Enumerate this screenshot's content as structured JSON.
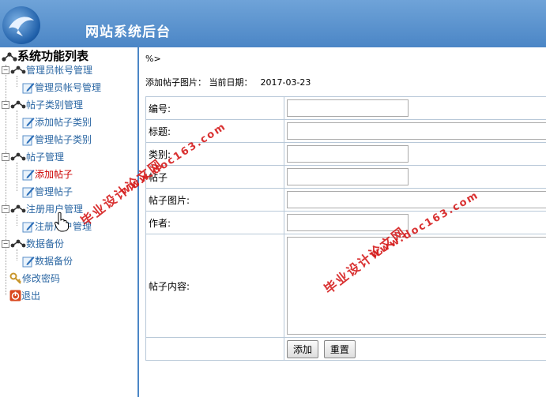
{
  "header": {
    "title": "网站系统后台"
  },
  "sidebar": {
    "root": "系统功能列表",
    "groups": [
      {
        "label": "管理员帐号管理",
        "items": [
          "管理员帐号管理"
        ]
      },
      {
        "label": "帖子类别管理",
        "items": [
          "添加帖子类别",
          "管理帖子类别"
        ]
      },
      {
        "label": "帖子管理",
        "items": [
          "添加帖子",
          "管理帖子"
        ]
      },
      {
        "label": "注册用户管理",
        "items": [
          "注册用户管理"
        ]
      },
      {
        "label": "数据备份",
        "items": [
          "数据备份"
        ]
      }
    ],
    "change_password": "修改密码",
    "logout": "退出"
  },
  "main": {
    "stray_text": "%>",
    "page_label": "添加帖子图片：",
    "date_label": "当前日期：",
    "date_value": "2017-03-23",
    "fields": [
      {
        "label": "编号:"
      },
      {
        "label": "标题:"
      },
      {
        "label": "类别:"
      },
      {
        "label": "帖子"
      },
      {
        "label": "帖子图片:"
      },
      {
        "label": "作者:"
      },
      {
        "label": "帖子内容:"
      }
    ],
    "submit_label": "添加",
    "reset_label": "重置"
  },
  "watermark": {
    "cn": "毕业设计论文网",
    "url": "www.doc163.com"
  },
  "colors": {
    "header": "#4b86c6",
    "link": "#2b67a3",
    "selected": "#cc0000",
    "watermark": "#d51c1c"
  }
}
